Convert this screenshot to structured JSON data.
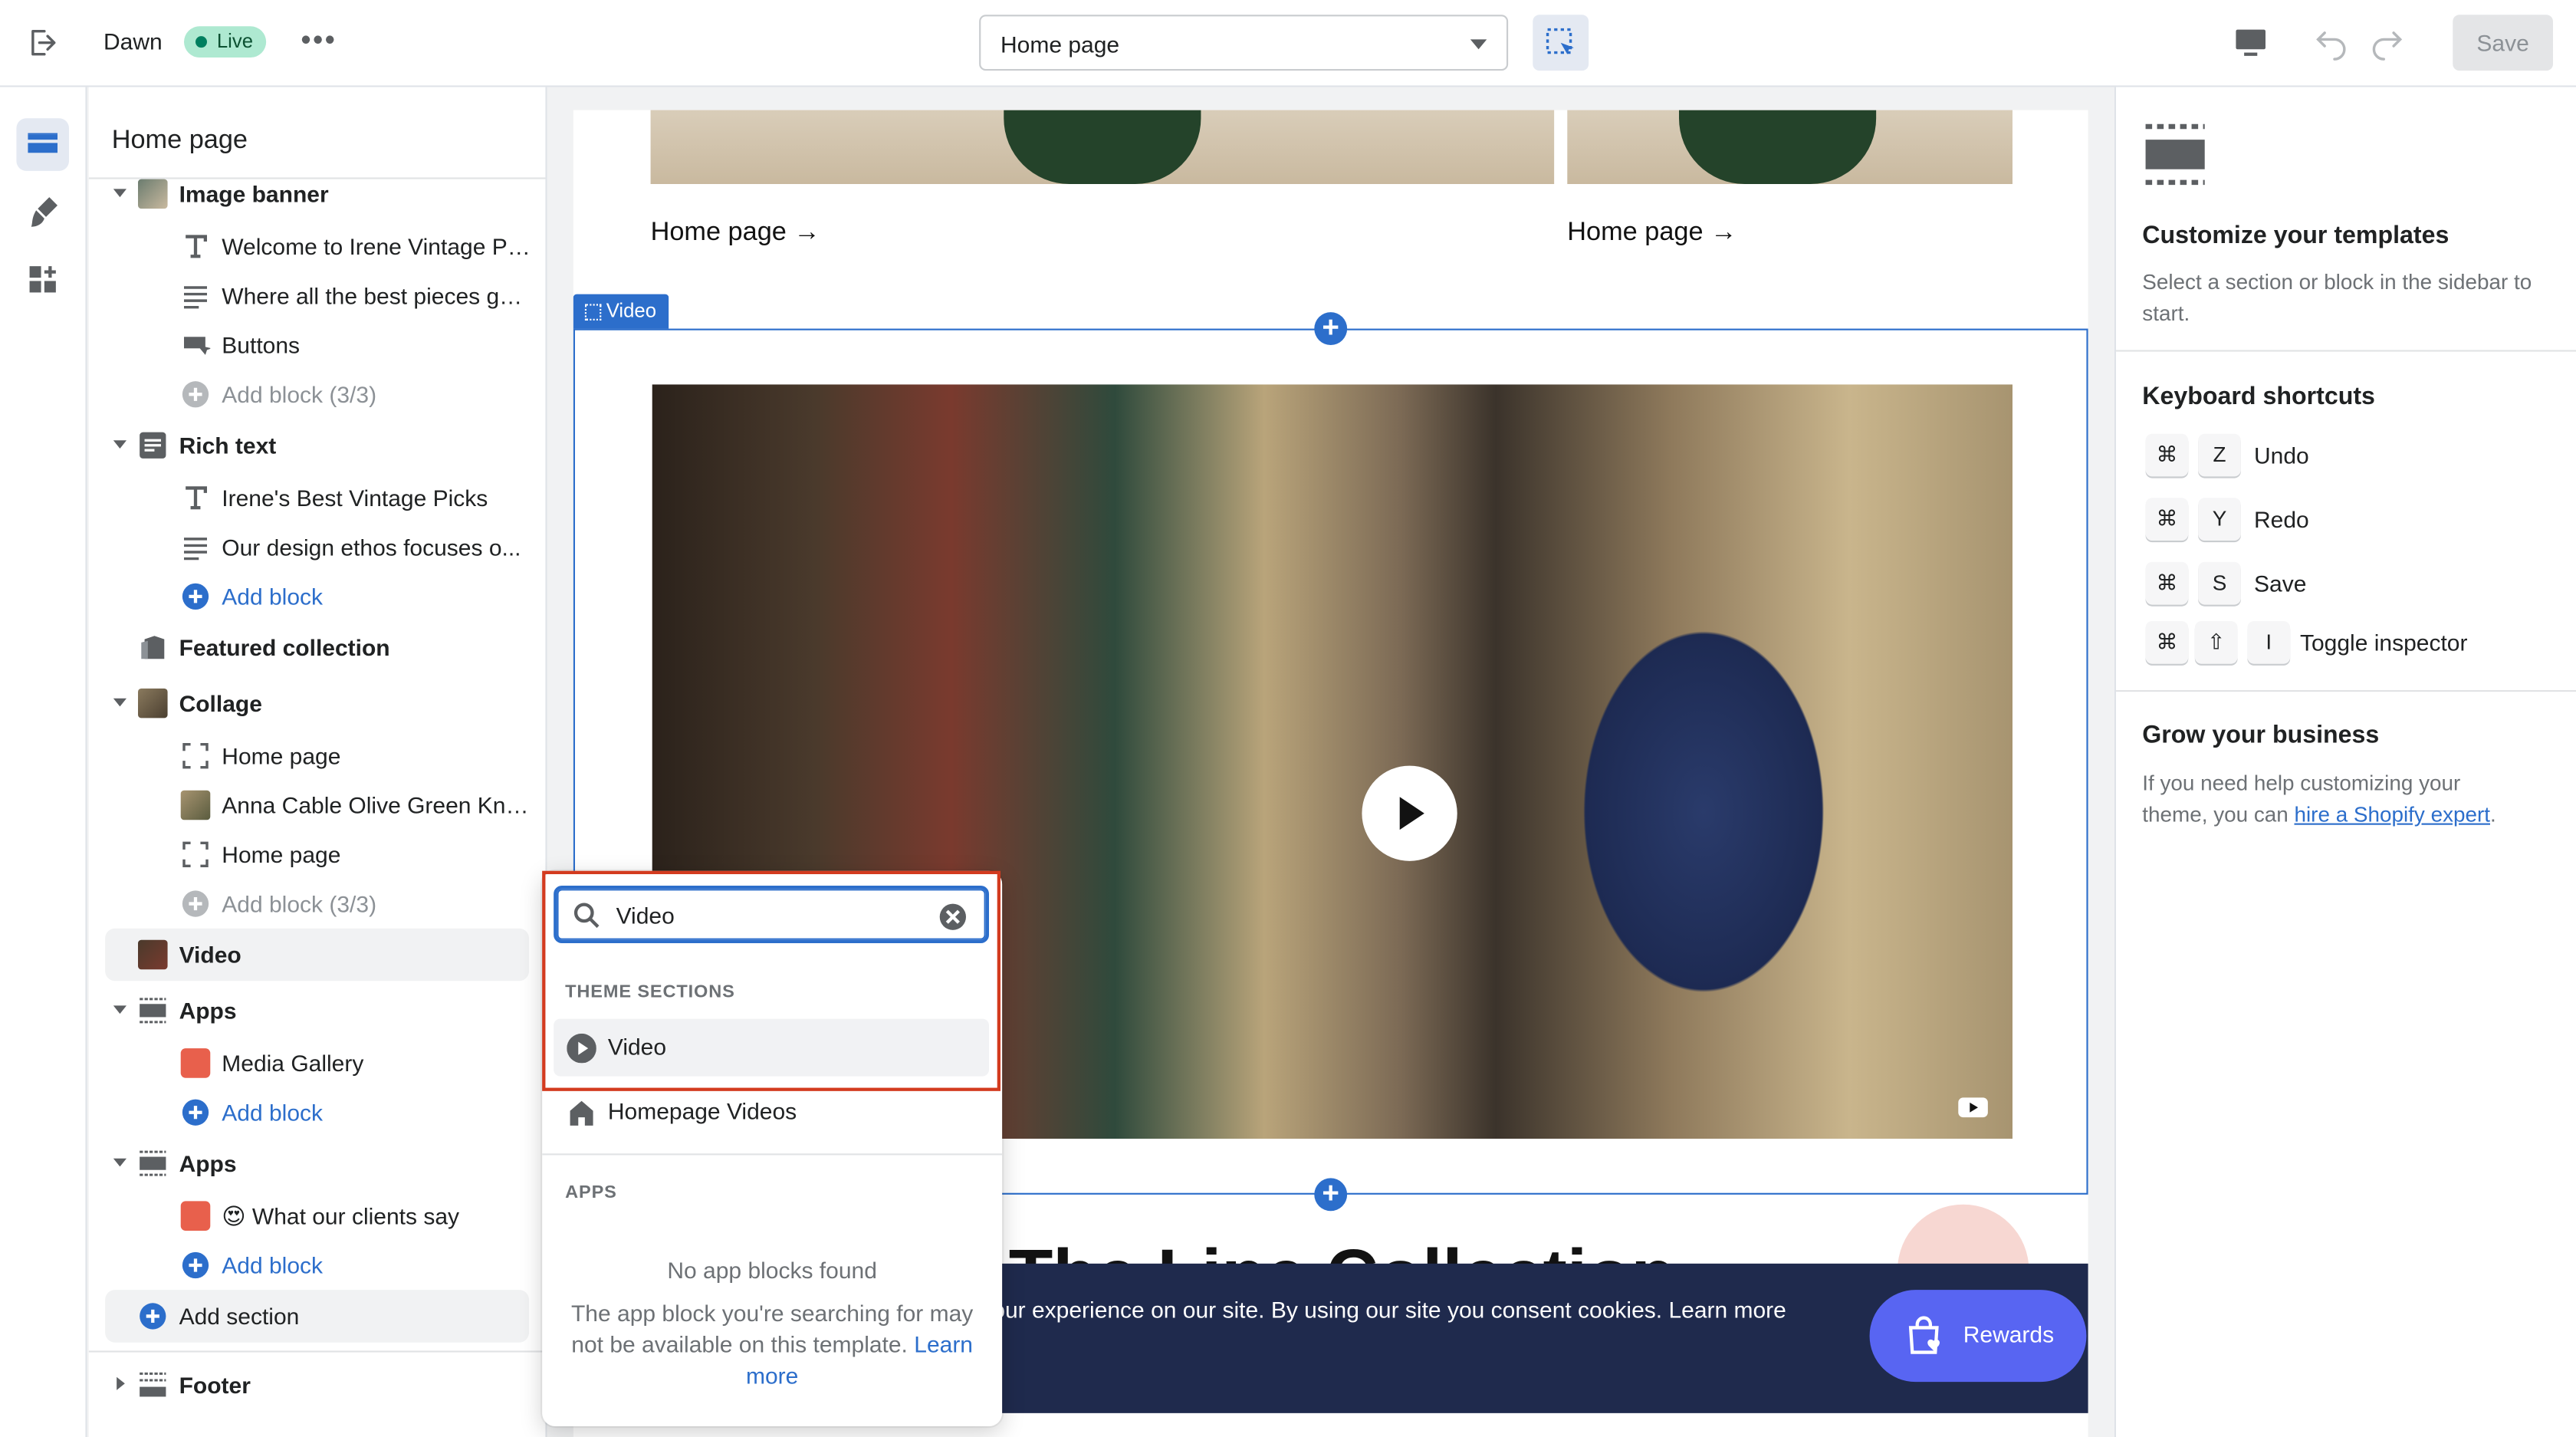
{
  "topbar": {
    "theme_name": "Dawn",
    "live_label": "Live",
    "page_selector": "Home page",
    "save_label": "Save"
  },
  "sidebar": {
    "title": "Home page",
    "image_banner": {
      "label": "Image banner",
      "blocks": [
        "Welcome to Irene Vintage Pi...",
        "Where all the best pieces ga...",
        "Buttons"
      ],
      "add_block": "Add block (3/3)"
    },
    "rich_text": {
      "label": "Rich text",
      "blocks": [
        "Irene's Best Vintage Picks",
        "Our design ethos focuses o..."
      ],
      "add_block": "Add block"
    },
    "featured_collection": "Featured collection",
    "collage": {
      "label": "Collage",
      "blocks": [
        "Home page",
        "Anna Cable Olive Green Knit...",
        "Home page"
      ],
      "add_block": "Add block (3/3)"
    },
    "video": "Video",
    "apps1": {
      "label": "Apps",
      "blocks": [
        "Media Gallery"
      ],
      "add_block": "Add block"
    },
    "apps2": {
      "label": "Apps",
      "blocks": [
        "😍 What our clients say"
      ],
      "add_block": "Add block"
    },
    "add_section": "Add section",
    "footer": "Footer"
  },
  "canvas": {
    "home_link_1": "Home page →",
    "home_link_2": "Home page →",
    "video_tag": "Video",
    "heading_peek": "The Line Collection",
    "cookie_text": "our experience on our site. By using our site you consent cookies. Learn more",
    "rewards_label": "Rewards"
  },
  "popover": {
    "search_value": "Video",
    "theme_sections_heading": "THEME SECTIONS",
    "theme_sections": [
      "Video",
      "Homepage Videos"
    ],
    "apps_heading": "APPS",
    "no_apps_title": "No app blocks found",
    "no_apps_desc": "The app block you're searching for may not be available on this template.",
    "learn_more": "Learn more"
  },
  "right_panel": {
    "customize_title": "Customize your templates",
    "customize_desc": "Select a section or block in the sidebar to start.",
    "shortcuts_title": "Keyboard shortcuts",
    "shortcuts": [
      {
        "keys": [
          "⌘",
          "Z"
        ],
        "label": "Undo"
      },
      {
        "keys": [
          "⌘",
          "Y"
        ],
        "label": "Redo"
      },
      {
        "keys": [
          "⌘",
          "S"
        ],
        "label": "Save"
      },
      {
        "keys": [
          "⌘",
          "⇧",
          "I"
        ],
        "label": "Toggle inspector"
      }
    ],
    "grow_title": "Grow your business",
    "grow_desc_prefix": "If you need help customizing your theme, you can ",
    "grow_link": "hire a Shopify expert",
    "grow_desc_suffix": "."
  },
  "colors": {
    "accent": "#2c6ecb",
    "live_badge": "#aee9d1",
    "highlight_border": "#d33b1f",
    "rewards": "#5865f2",
    "cookie_bar": "#1f2a4d"
  }
}
